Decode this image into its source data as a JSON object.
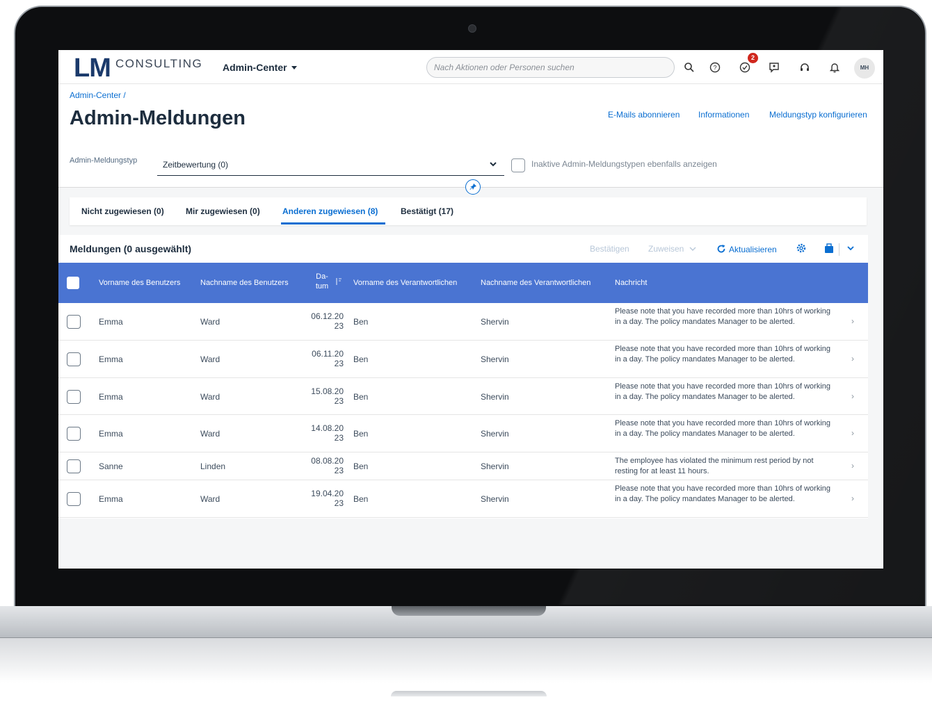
{
  "shell": {
    "logo_main": "LM",
    "logo_sub": "CONSULTING",
    "app_title": "Admin-Center",
    "search_placeholder": "Nach Aktionen oder Personen suchen",
    "notification_badge": "2",
    "avatar_initials": "MH",
    "icons": [
      "search-icon",
      "help-icon",
      "approvals-icon",
      "feedback-icon",
      "support-icon",
      "bell-icon"
    ]
  },
  "header": {
    "breadcrumb": "Admin-Center /",
    "title": "Admin-Meldungen",
    "links": [
      "E-Mails abonnieren",
      "Informationen",
      "Meldungstyp konfigurieren"
    ]
  },
  "filter": {
    "label": "Admin-Meldungstyp",
    "selected_value": "Zeitbewertung (0)",
    "checkbox_label": "Inaktive Admin-Meldungstypen ebenfalls anzeigen"
  },
  "tabs": [
    {
      "label": "Nicht zugewiesen (0)",
      "active": false
    },
    {
      "label": "Mir zugewiesen (0)",
      "active": false
    },
    {
      "label": "Anderen zugewiesen (8)",
      "active": true
    },
    {
      "label": "Bestätigt (17)",
      "active": false
    }
  ],
  "table": {
    "title": "Meldungen (0 ausgewählt)",
    "toolbar": {
      "confirm": "Bestätigen",
      "assign": "Zuweisen",
      "refresh": "Aktualisieren"
    },
    "columns": {
      "first_name": "Vorname des Benutzers",
      "last_name": "Nachname des Benutzers",
      "date_line1": "Da-",
      "date_line2": "tum",
      "resp_first": "Vorname des Verantwortlichen",
      "resp_last": "Nachname des Verantwortlichen",
      "message": "Nachricht"
    },
    "rows": [
      {
        "first": "Emma",
        "last": "Ward",
        "date1": "06.12.20",
        "date2": "23",
        "rfirst": "Ben",
        "rlast": "Shervin",
        "msg": "Please note that you have recorded more than 10hrs of working in a day. The policy mandates Manager to be alerted."
      },
      {
        "first": "Emma",
        "last": "Ward",
        "date1": "06.11.20",
        "date2": "23",
        "rfirst": "Ben",
        "rlast": "Shervin",
        "msg": "Please note that you have recorded more than 10hrs of working in a day. The policy mandates Manager to be alerted."
      },
      {
        "first": "Emma",
        "last": "Ward",
        "date1": "15.08.20",
        "date2": "23",
        "rfirst": "Ben",
        "rlast": "Shervin",
        "msg": "Please note that you have recorded more than 10hrs of working in a day. The policy mandates Manager to be alerted."
      },
      {
        "first": "Emma",
        "last": "Ward",
        "date1": "14.08.20",
        "date2": "23",
        "rfirst": "Ben",
        "rlast": "Shervin",
        "msg": "Please note that you have recorded more than 10hrs of working in a day. The policy mandates Manager to be alerted."
      },
      {
        "first": "Sanne",
        "last": "Linden",
        "date1": "08.08.20",
        "date2": "23",
        "rfirst": "Ben",
        "rlast": "Shervin",
        "msg": "The employee has violated the minimum rest period by not resting for at least 11 hours."
      },
      {
        "first": "Emma",
        "last": "Ward",
        "date1": "19.04.20",
        "date2": "23",
        "rfirst": "Ben",
        "rlast": "Shervin",
        "msg": "Please note that you have recorded more than 10hrs of working in a day. The policy mandates Manager to be alerted."
      }
    ]
  },
  "colors": {
    "accent": "#0a6ed1",
    "table_header": "#4a74d2",
    "brand": "#1b3a6b",
    "badge": "#d0271d"
  }
}
